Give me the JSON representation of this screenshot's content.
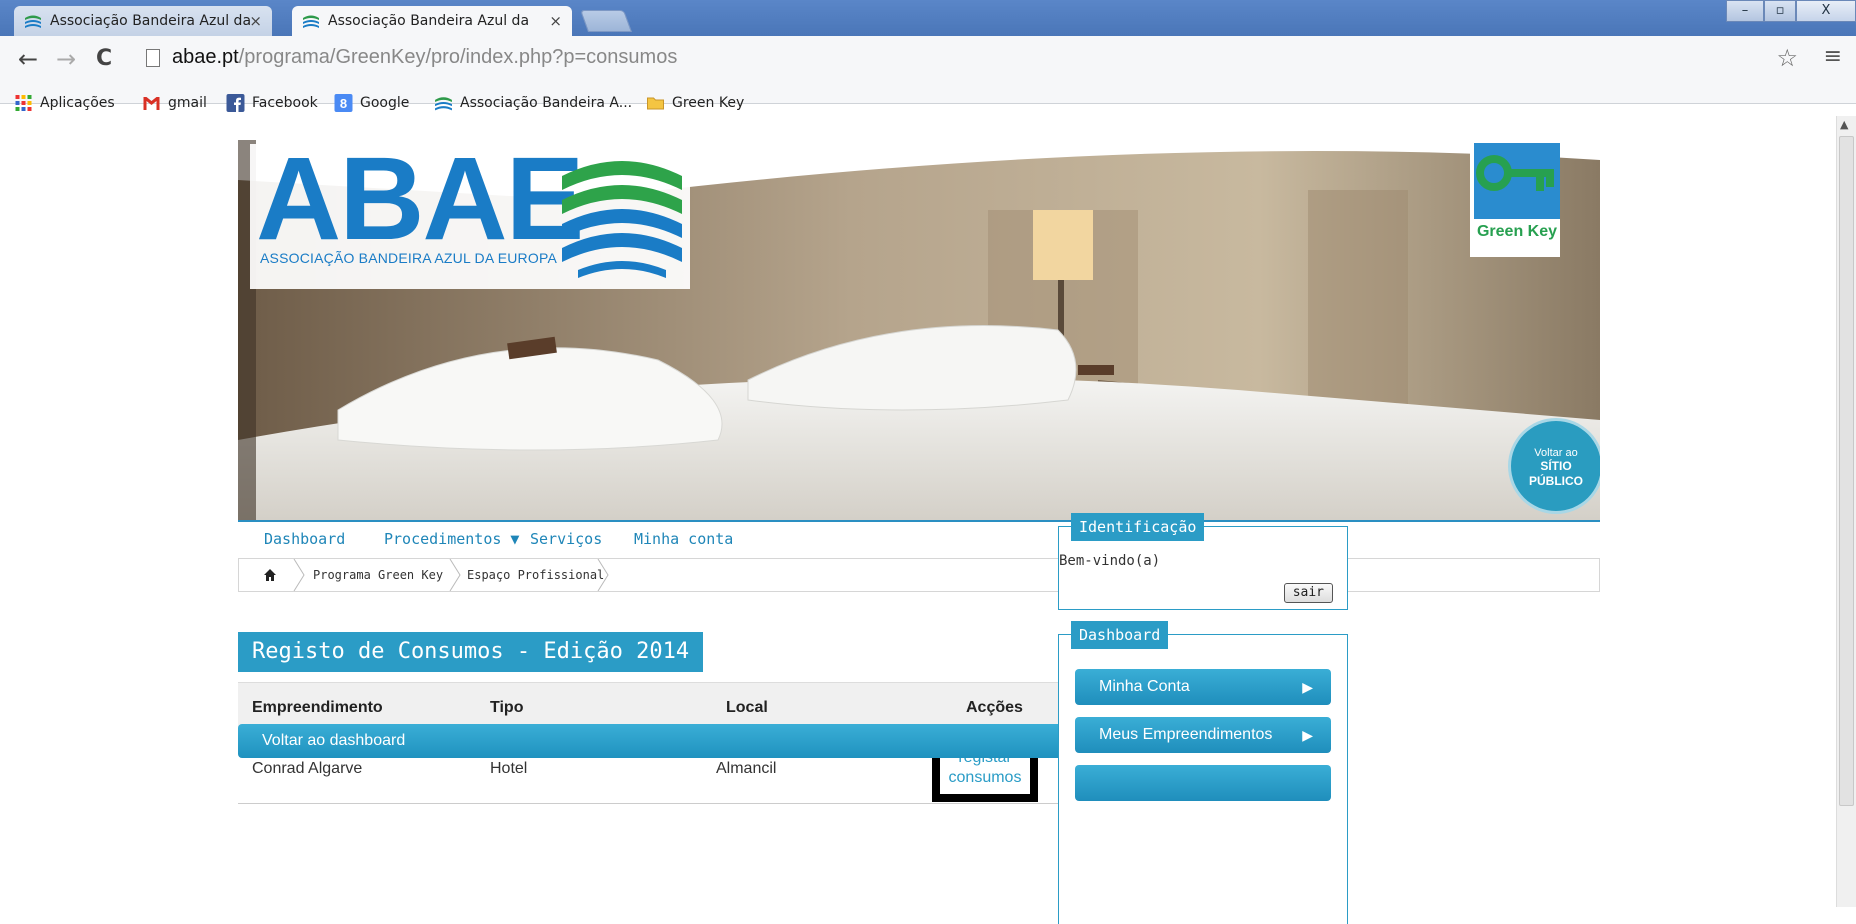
{
  "browser": {
    "tabs": [
      {
        "title": "Associação Bandeira Azul da",
        "active": false
      },
      {
        "title": "Associação Bandeira Azul da",
        "active": true
      }
    ],
    "tab_close": "×",
    "window_buttons": {
      "minimize": "–",
      "restore": "▫",
      "close": "X"
    },
    "url": {
      "host": "abae.pt",
      "path": "/programa/GreenKey/pro/index.php?p=consumos"
    },
    "bookmarks": [
      {
        "label": "Aplicações",
        "icon": "apps-grid-icon"
      },
      {
        "label": "gmail",
        "icon": "gmail-icon"
      },
      {
        "label": "Facebook",
        "icon": "facebook-icon"
      },
      {
        "label": "Google",
        "icon": "google-icon"
      },
      {
        "label": "Associação Bandeira A...",
        "icon": "abae-favicon-icon"
      },
      {
        "label": "Green Key",
        "icon": "folder-icon"
      }
    ]
  },
  "banner": {
    "logo_text": "ABAE",
    "logo_subtitle": "ASSOCIAÇÃO BANDEIRA AZUL DA EUROPA",
    "green_key_label": "Green Key",
    "sitio_line1": "Voltar ao",
    "sitio_line2": "SÍTIO",
    "sitio_line3": "PÚBLICO"
  },
  "nav": {
    "items": [
      "Dashboard",
      "Procedimentos ▼",
      "Serviços",
      "Minha conta"
    ]
  },
  "breadcrumb": {
    "items": [
      "Programa Green Key",
      "Espaço Profissional"
    ]
  },
  "main": {
    "title": "Registo de Consumos - Edição 2014",
    "table": {
      "headers": [
        "Empreendimento",
        "Tipo",
        "Local",
        "Acções"
      ],
      "rows": [
        {
          "empreendimento": "Conrad Algarve",
          "tipo": "Hotel",
          "local": "Almancil",
          "action_line1": "registar",
          "action_line2": "consumos"
        }
      ]
    },
    "back_button": "Voltar ao dashboard"
  },
  "sidebar": {
    "identificacao": {
      "title": "Identificação",
      "welcome": "Bem-vindo(a)",
      "logout": "sair"
    },
    "dashboard": {
      "title": "Dashboard",
      "buttons": [
        "Minha Conta",
        "Meus Empreendimentos"
      ]
    }
  },
  "colors": {
    "accent": "#2b9cc6",
    "brand_blue": "#1a7cc6",
    "green_key": "#27a050"
  }
}
